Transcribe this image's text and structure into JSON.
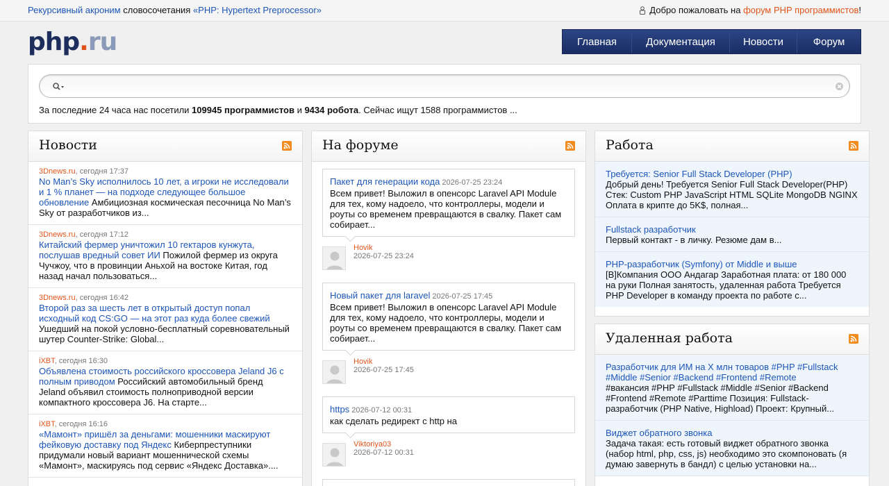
{
  "topbar": {
    "acronym_link": "Рекурсивный акроним",
    "acronym_text": " словосочетания ",
    "acronym_value": "«PHP: Hypertext Preprocessor»",
    "welcome_text": "Добро пожаловать на ",
    "welcome_link": "форум PHP программистов",
    "welcome_end": "!"
  },
  "logo": {
    "php": "php",
    "dot": ".",
    "ru": "ru"
  },
  "nav": [
    {
      "label": "Главная"
    },
    {
      "label": "Документация"
    },
    {
      "label": "Новости"
    },
    {
      "label": "Форум"
    }
  ],
  "search": {
    "placeholder": "",
    "stats_prefix": "За последние 24 часа нас посетили ",
    "stats_programmers": "109945 программистов",
    "stats_and": " и ",
    "stats_robots": "9434 робота",
    "stats_suffix": ". Сейчас ищут 1588 программистов ..."
  },
  "news": {
    "title": "Новости",
    "items": [
      {
        "source": "3Dnews.ru",
        "time": ", сегодня 17:37",
        "title": "No Man’s Sky исполнилось 10 лет, а игроки не исследовали и 1 % планет — на подходе следующее большое обновление",
        "excerpt": " Амбициозная космическая песочница No Man’s Sky от разработчиков из..."
      },
      {
        "source": "3Dnews.ru",
        "time": ", сегодня 17:12",
        "title": "Китайский фермер уничтожил 10 гектаров кунжута, послушав вредный совет ИИ",
        "excerpt": " Пожилой фермер из округа Чучжоу, что в провинции Аньхой на востоке Китая, год назад начал пользоваться..."
      },
      {
        "source": "3Dnews.ru",
        "time": ", сегодня 16:42",
        "title": "Второй раз за шесть лет в открытый доступ попал исходный код CS:GO — на этот раз куда более свежий",
        "excerpt": " Ушедший на покой условно-бесплатный соревновательный шутер Counter-Strike: Global..."
      },
      {
        "source": "iXBT",
        "time": ", сегодня 16:30",
        "title": "Объявлена стоимость российского кроссовера Jeland J6 с полным приводом",
        "excerpt": " Российский автомобильный бренд Jeland объявил стоимость полноприводной версии компактного кроссовера J6. На старте..."
      },
      {
        "source": "iXBT",
        "time": ", сегодня 16:16",
        "title": "«Мамонт» пришёл за деньгами: мошенники маскируют фейковую доставку под Яндекс",
        "excerpt": " Киберпреступники придумали новый вариант мошеннической схемы «Мамонт», маскируясь под сервис «Яндекс Доставка»...."
      }
    ]
  },
  "forum": {
    "title": "На форуме",
    "items": [
      {
        "title": "Пакет для генерации кода",
        "date": " 2026-07-25 23:24",
        "text": "Всем привет! Выложил в опенсорс Laravel API Module для тех, кому надоело, что контроллеры, модели и роуты со временем превращаются в свалку. Пакет сам собирает...",
        "author": "Hovik",
        "author_date": "2026-07-25 23:24"
      },
      {
        "title": "Новый пакет для laravel",
        "date": " 2026-07-25 17:45",
        "text": "Всем привет! Выложил в опенсорс Laravel API Module для тех, кому надоело, что контроллеры, модели и роуты со временем превращаются в свалку. Пакет сам собирает...",
        "author": "Hovik",
        "author_date": "2026-07-25 17:45"
      },
      {
        "title": "https",
        "date": " 2026-07-12 00:31",
        "text": "как сделать редирект с http на",
        "author": "Viktoriya03",
        "author_date": "2026-07-12 00:31"
      }
    ]
  },
  "jobs": {
    "title": "Работа",
    "items": [
      {
        "title": "Требуется: Senior Full Stack Developer (PHP)",
        "text": "Добрый день! Требуется Senior Full Stack Developer(PHP) Стек: Custom PHP JavaScript HTML SQLite MongoDB NGINX Оплата в крипте до 5K$, полная..."
      },
      {
        "title": "Fullstack разработчик",
        "text": "Первый контакт - в личку. Резюме дам в..."
      },
      {
        "title": "PHP-разработчик (Symfony) от Middle и выше",
        "text": "[B]Компания ООО Андагар Заработная плата: от 180 000 на руки Полная занятость, удаленная работа Требуется PHP Developer в команду проекта по работе с..."
      }
    ]
  },
  "remote": {
    "title": "Удаленная работа",
    "items": [
      {
        "title": "Разработчик для ИМ на Х млн товаров #PHP #Fullstack #Middle #Senior #Backend #Frontend #Remote",
        "text": "#вакансия #PHP #Fullstack #Middle #Senior #Backend #Frontend #Remote #Parttime Позиция: Fullstack-разработчик (PHP Native, Highload) Проект: Крупный..."
      },
      {
        "title": "Виджет обратного звонка",
        "text": "Задача такая: есть готовый виджет обратного звонка (набор html, php, css, js) необходимо это скомпоновать (я думаю завернуть в бандл) с целью установки на..."
      }
    ]
  },
  "colors": {
    "brand": "#1d2e5c",
    "accent": "#e0541b",
    "link": "#1d56b8",
    "nav": "#1f3470",
    "rss": "#f28c1f"
  },
  "icons": {
    "user": "person-icon",
    "search": "search-icon",
    "clear": "clear-icon",
    "feed": "rss-icon",
    "avatar": "avatar"
  }
}
